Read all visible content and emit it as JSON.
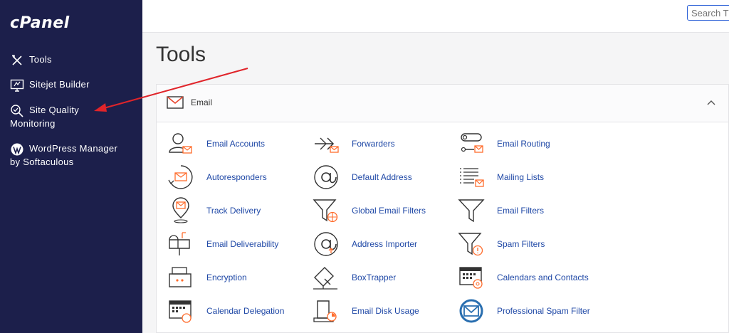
{
  "brand": {
    "logo": "cPanel"
  },
  "sidebar": {
    "items": [
      {
        "label": "Tools",
        "icon": "tools-icon"
      },
      {
        "label": "Sitejet Builder",
        "icon": "monitor-icon"
      },
      {
        "label": "Site Quality",
        "sub": "Monitoring",
        "icon": "magnifier-check-icon"
      },
      {
        "label": "WordPress Manager",
        "sub": "by Softaculous",
        "icon": "wordpress-icon"
      }
    ]
  },
  "topbar": {
    "search_placeholder": "Search T"
  },
  "page": {
    "title": "Tools"
  },
  "section": {
    "title": "Email",
    "icon": "envelope-icon"
  },
  "tools": [
    {
      "label": "Email Accounts",
      "icon": "email-accounts-icon"
    },
    {
      "label": "Forwarders",
      "icon": "forwarders-icon"
    },
    {
      "label": "Email Routing",
      "icon": "email-routing-icon"
    },
    {
      "label": "Autoresponders",
      "icon": "autoresponders-icon"
    },
    {
      "label": "Default Address",
      "icon": "default-address-icon"
    },
    {
      "label": "Mailing Lists",
      "icon": "mailing-lists-icon"
    },
    {
      "label": "Track Delivery",
      "icon": "track-delivery-icon"
    },
    {
      "label": "Global Email Filters",
      "icon": "global-filters-icon"
    },
    {
      "label": "Email Filters",
      "icon": "email-filters-icon"
    },
    {
      "label": "Email Deliverability",
      "icon": "mailbox-icon"
    },
    {
      "label": "Address Importer",
      "icon": "address-importer-icon"
    },
    {
      "label": "Spam Filters",
      "icon": "spam-filters-icon"
    },
    {
      "label": "Encryption",
      "icon": "encryption-icon"
    },
    {
      "label": "BoxTrapper",
      "icon": "boxtrapper-icon"
    },
    {
      "label": "Calendars and Contacts",
      "icon": "calendars-contacts-icon"
    },
    {
      "label": "Calendar Delegation",
      "icon": "calendar-delegation-icon"
    },
    {
      "label": "Email Disk Usage",
      "icon": "disk-usage-icon"
    },
    {
      "label": "Professional Spam Filter",
      "icon": "professional-spam-filter-icon"
    }
  ],
  "colors": {
    "sidebar_bg": "#1c1f4b",
    "link": "#1f48a6",
    "accent": "#ff6c2c",
    "annotation_arrow": "#e0242a"
  }
}
